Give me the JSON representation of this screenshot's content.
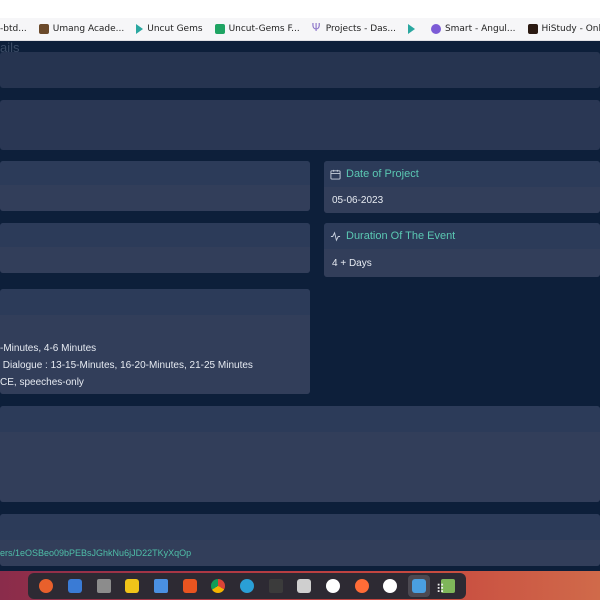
{
  "bookmarks": [
    {
      "label": "-btd...",
      "icon": "none"
    },
    {
      "label": "Umang Acade...",
      "icon": "brown"
    },
    {
      "label": "Uncut Gems",
      "icon": "play"
    },
    {
      "label": "Uncut-Gems F...",
      "icon": "sheet"
    },
    {
      "label": "Projects - Das...",
      "icon": "branch"
    },
    {
      "label": "",
      "icon": "play"
    },
    {
      "label": "Smart - Angul...",
      "icon": "cap"
    },
    {
      "label": "HiStudy - Onli...",
      "icon": "dark"
    }
  ],
  "page": {
    "faint_title": "ails"
  },
  "date_card": {
    "label": "Date of Project",
    "value": "05-06-2023"
  },
  "duration_card": {
    "label": "Duration Of The Event",
    "value": "4 + Days"
  },
  "details_card": {
    "line1": "-Minutes, 4-6 Minutes",
    "line2": " Dialogue : 13-15-Minutes, 16-20-Minutes, 21-25 Minutes",
    "line3": "CE, speeches-only"
  },
  "link_card": {
    "url": "ers/1eOSBeo09bPEBsJGhkNu6jJD22TKyXqOp"
  },
  "dock": {
    "apps": [
      "firefox-icon",
      "messages-icon",
      "files-icon",
      "clock-icon",
      "document-icon",
      "software-icon",
      "chrome-icon",
      "help-icon",
      "terminal-icon",
      "screenshot-icon",
      "slack-icon",
      "postman-icon",
      "kde-connect-icon",
      "vscode-icon",
      "trash-icon"
    ],
    "grid_label": "⠿"
  },
  "colors": {
    "background": "#0d1f3a",
    "card": "#263450",
    "accent": "#5bc8b3"
  }
}
